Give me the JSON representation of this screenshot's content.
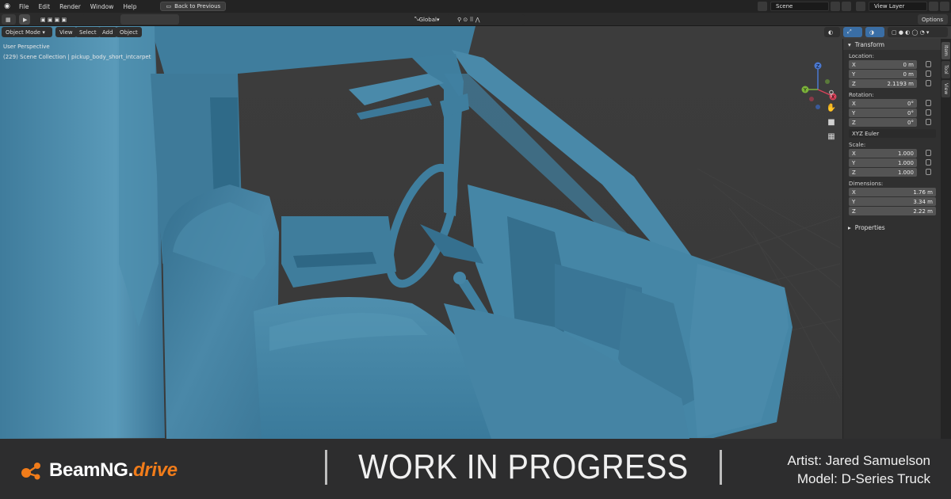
{
  "menu": {
    "items": [
      "File",
      "Edit",
      "Render",
      "Window",
      "Help"
    ],
    "back_button": "Back to Previous",
    "scene": "Scene",
    "view_layer": "View Layer"
  },
  "viewport_header": {
    "mode": "Object Mode",
    "view": "View",
    "select": "Select",
    "add": "Add",
    "object": "Object",
    "orientation": "Global",
    "options": "Options"
  },
  "viewport": {
    "perspective": "User Perspective",
    "collection": "(229) Scene Collection | pickup_body_short_intcarpet",
    "model_color": "#4a88a8",
    "background_color": "#3a3a3a"
  },
  "gizmo": {
    "x": "X",
    "y": "Y",
    "z": "Z"
  },
  "npanel": {
    "transform": "Transform",
    "location_label": "Location:",
    "location": [
      {
        "axis": "X",
        "value": "0 m"
      },
      {
        "axis": "Y",
        "value": "0 m"
      },
      {
        "axis": "Z",
        "value": "2.1193 m"
      }
    ],
    "rotation_label": "Rotation:",
    "rotation": [
      {
        "axis": "X",
        "value": "0°"
      },
      {
        "axis": "Y",
        "value": "0°"
      },
      {
        "axis": "Z",
        "value": "0°"
      }
    ],
    "rotation_mode": "XYZ Euler",
    "scale_label": "Scale:",
    "scale": [
      {
        "axis": "X",
        "value": "1.000"
      },
      {
        "axis": "Y",
        "value": "1.000"
      },
      {
        "axis": "Z",
        "value": "1.000"
      }
    ],
    "dimensions_label": "Dimensions:",
    "dimensions": [
      {
        "axis": "X",
        "value": "1.76 m"
      },
      {
        "axis": "Y",
        "value": "3.34 m"
      },
      {
        "axis": "Z",
        "value": "2.22 m"
      }
    ],
    "properties": "Properties",
    "tabs": [
      "Item",
      "Tool",
      "View"
    ]
  },
  "banner": {
    "brand_main": "BeamNG.",
    "brand_accent": "drive",
    "wip": "WORK IN PROGRESS",
    "artist": "Artist: Jared Samuelson",
    "model": "Model: D-Series Truck",
    "accent_color": "#f17c1a"
  }
}
